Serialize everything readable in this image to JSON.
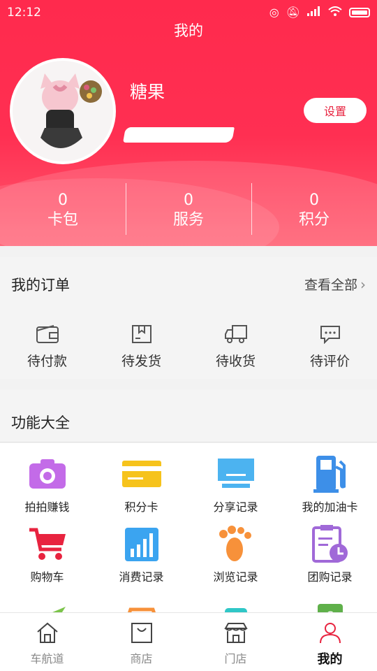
{
  "status_bar": {
    "time": "12:12"
  },
  "header": {
    "title": "我的"
  },
  "profile": {
    "username": "糖果",
    "settings_label": "设置"
  },
  "stats": [
    {
      "value": "0",
      "label": "卡包"
    },
    {
      "value": "0",
      "label": "服务"
    },
    {
      "value": "0",
      "label": "积分"
    }
  ],
  "orders": {
    "title": "我的订单",
    "view_all": "查看全部",
    "items": [
      {
        "label": "待付款",
        "icon": "wallet-icon"
      },
      {
        "label": "待发货",
        "icon": "package-icon"
      },
      {
        "label": "待收货",
        "icon": "truck-icon"
      },
      {
        "label": "待评价",
        "icon": "comment-icon"
      }
    ]
  },
  "features": {
    "title": "功能大全",
    "items": [
      {
        "label": "拍拍赚钱",
        "icon": "camera-icon",
        "color": "#c36be8"
      },
      {
        "label": "积分卡",
        "icon": "card-icon",
        "color": "#f6c31c"
      },
      {
        "label": "分享记录",
        "icon": "monitor-icon",
        "color": "#4cb3f0"
      },
      {
        "label": "我的加油卡",
        "icon": "fuel-pump-icon",
        "color": "#3d8fe8"
      },
      {
        "label": "购物车",
        "icon": "cart-icon",
        "color": "#e8233f"
      },
      {
        "label": "消费记录",
        "icon": "bar-chart-icon",
        "color": "#3ba4f0"
      },
      {
        "label": "浏览记录",
        "icon": "footprint-icon",
        "color": "#f7913a"
      },
      {
        "label": "团购记录",
        "icon": "clipboard-clock-icon",
        "color": "#a069d8"
      }
    ]
  },
  "nav": [
    {
      "label": "车航道",
      "icon": "home-icon"
    },
    {
      "label": "商店",
      "icon": "shopping-bag-icon"
    },
    {
      "label": "门店",
      "icon": "storefront-icon"
    },
    {
      "label": "我的",
      "icon": "user-icon",
      "active": true
    }
  ],
  "colors": {
    "brand": "#ff2a4d"
  }
}
